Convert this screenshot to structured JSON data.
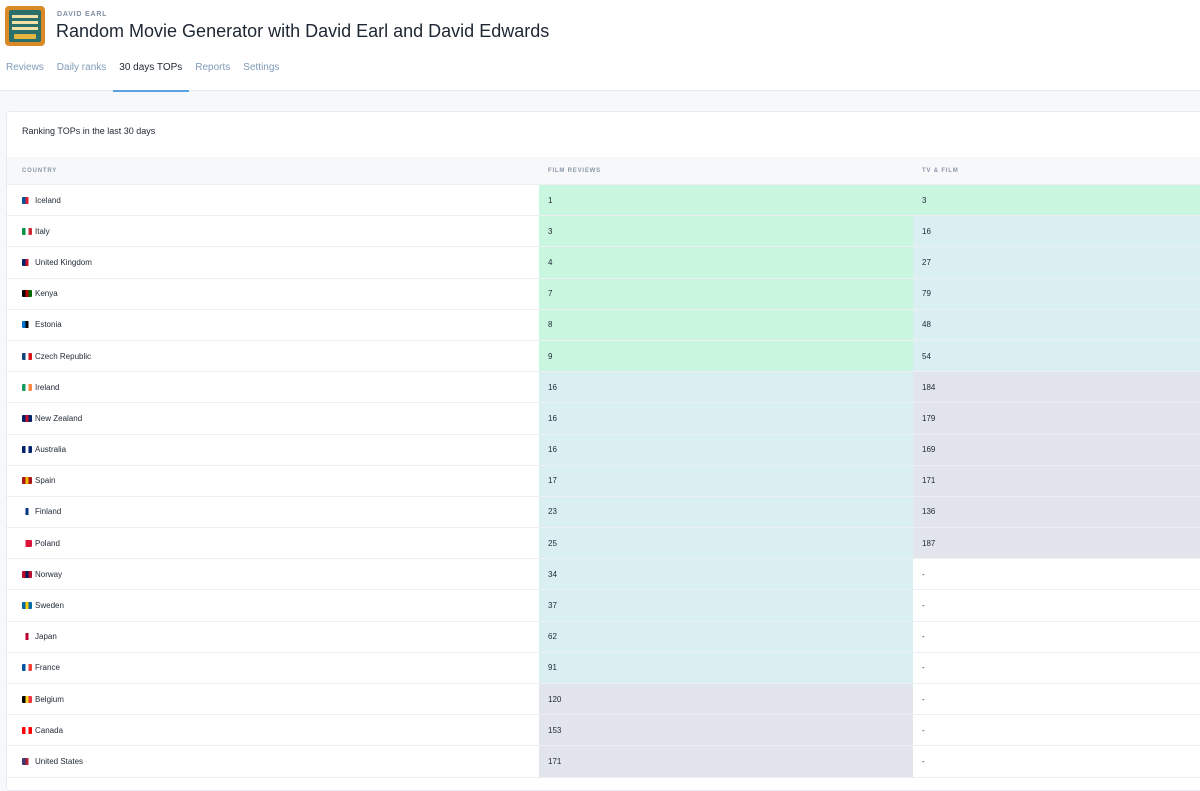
{
  "header": {
    "author": "DAVID EARL",
    "title": "Random Movie Generator with David Earl and David Edwards",
    "cover_icon": "podcast-cover-image"
  },
  "tabs": [
    {
      "label": "Reviews",
      "active": false
    },
    {
      "label": "Daily ranks",
      "active": false
    },
    {
      "label": "30 days TOPs",
      "active": true
    },
    {
      "label": "Reports",
      "active": false
    },
    {
      "label": "Settings",
      "active": false
    }
  ],
  "card": {
    "title": "Ranking TOPs in the last 30 days",
    "columns": {
      "country": "COUNTRY",
      "film": "FILM REVIEWS",
      "tv": "TV & FILM"
    }
  },
  "colors": {
    "top10": "#c9f6df",
    "top100": "#d9eff2",
    "rest": "#e2e5ec",
    "accent": "#5aa3e0"
  },
  "rows": [
    {
      "country": "Iceland",
      "film": "1",
      "tv": "3",
      "flag": [
        "#02529c",
        "#dc1e35",
        "#ffffff"
      ]
    },
    {
      "country": "Italy",
      "film": "3",
      "tv": "16",
      "flag": [
        "#009246",
        "#ffffff",
        "#ce2b37"
      ]
    },
    {
      "country": "United Kingdom",
      "film": "4",
      "tv": "27",
      "flag": [
        "#012169",
        "#c8102e",
        "#ffffff"
      ]
    },
    {
      "country": "Kenya",
      "film": "7",
      "tv": "79",
      "flag": [
        "#000000",
        "#bb0000",
        "#006600"
      ]
    },
    {
      "country": "Estonia",
      "film": "8",
      "tv": "48",
      "flag": [
        "#0072ce",
        "#000000",
        "#ffffff"
      ]
    },
    {
      "country": "Czech Republic",
      "film": "9",
      "tv": "54",
      "flag": [
        "#11457e",
        "#ffffff",
        "#d7141a"
      ]
    },
    {
      "country": "Ireland",
      "film": "16",
      "tv": "184",
      "flag": [
        "#169b62",
        "#ffffff",
        "#ff883e"
      ]
    },
    {
      "country": "New Zealand",
      "film": "16",
      "tv": "179",
      "flag": [
        "#012169",
        "#c8102e",
        "#012169"
      ]
    },
    {
      "country": "Australia",
      "film": "16",
      "tv": "169",
      "flag": [
        "#012169",
        "#ffffff",
        "#012169"
      ]
    },
    {
      "country": "Spain",
      "film": "17",
      "tv": "171",
      "flag": [
        "#aa151b",
        "#f1bf00",
        "#aa151b"
      ]
    },
    {
      "country": "Finland",
      "film": "23",
      "tv": "136",
      "flag": [
        "#ffffff",
        "#003580",
        "#ffffff"
      ]
    },
    {
      "country": "Poland",
      "film": "25",
      "tv": "187",
      "flag": [
        "#ffffff",
        "#dc143c",
        "#dc143c"
      ]
    },
    {
      "country": "Norway",
      "film": "34",
      "tv": "-",
      "flag": [
        "#ba0c2f",
        "#00205b",
        "#ba0c2f"
      ]
    },
    {
      "country": "Sweden",
      "film": "37",
      "tv": "-",
      "flag": [
        "#006aa7",
        "#fecc00",
        "#006aa7"
      ]
    },
    {
      "country": "Japan",
      "film": "62",
      "tv": "-",
      "flag": [
        "#ffffff",
        "#bc002d",
        "#ffffff"
      ]
    },
    {
      "country": "France",
      "film": "91",
      "tv": "-",
      "flag": [
        "#0055a4",
        "#ffffff",
        "#ef4135"
      ]
    },
    {
      "country": "Belgium",
      "film": "120",
      "tv": "-",
      "flag": [
        "#000000",
        "#fdda24",
        "#ef3340"
      ]
    },
    {
      "country": "Canada",
      "film": "153",
      "tv": "-",
      "flag": [
        "#ff0000",
        "#ffffff",
        "#ff0000"
      ]
    },
    {
      "country": "United States",
      "film": "171",
      "tv": "-",
      "flag": [
        "#3c3b6e",
        "#b22234",
        "#ffffff"
      ]
    }
  ],
  "row_bands": {
    "film": [
      "g",
      "g",
      "g",
      "g",
      "g",
      "g",
      "b",
      "b",
      "b",
      "b",
      "b",
      "b",
      "b",
      "b",
      "b",
      "b",
      "n",
      "n",
      "n"
    ],
    "tv": [
      "g",
      "b",
      "b",
      "b",
      "b",
      "b",
      "n",
      "n",
      "n",
      "n",
      "n",
      "n",
      "w",
      "w",
      "w",
      "w",
      "w",
      "w",
      "w"
    ]
  }
}
